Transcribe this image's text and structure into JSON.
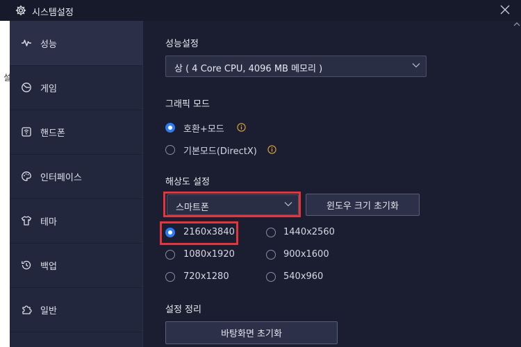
{
  "window": {
    "title": "시스템설정"
  },
  "left_edge_char": "설",
  "sidebar": {
    "items": [
      {
        "label": "성능",
        "icon": "pulse-icon",
        "active": true
      },
      {
        "label": "게임",
        "icon": "gauge-icon",
        "active": false
      },
      {
        "label": "핸드폰",
        "icon": "phone-icon",
        "active": false
      },
      {
        "label": "인터페이스",
        "icon": "palette-icon",
        "active": false
      },
      {
        "label": "테마",
        "icon": "shirt-icon",
        "active": false
      },
      {
        "label": "백업",
        "icon": "backup-icon",
        "active": false
      },
      {
        "label": "일반",
        "icon": "puzzle-icon",
        "active": false
      }
    ]
  },
  "performance": {
    "title": "성능설정",
    "selected": "상 ( 4 Core CPU, 4096 MB 메모리 )"
  },
  "graphics": {
    "title": "그래픽 모드",
    "options": [
      {
        "label": "호환+모드",
        "selected": true
      },
      {
        "label": "기본모드(DirectX)",
        "selected": false
      }
    ]
  },
  "resolution": {
    "title": "해상도 설정",
    "device_selected": "스마트폰",
    "reset_window_label": "윈도우 크기 초기화",
    "options": [
      {
        "label": "2160x3840",
        "selected": true
      },
      {
        "label": "1440x2560",
        "selected": false
      },
      {
        "label": "1080x1920",
        "selected": false
      },
      {
        "label": "900x1600",
        "selected": false
      },
      {
        "label": "720x1280",
        "selected": false
      },
      {
        "label": "540x960",
        "selected": false
      }
    ]
  },
  "cleanup": {
    "title": "설정 정리",
    "reset_desktop_label": "바탕화면 초기화"
  },
  "colors": {
    "accent": "#2d7cf2",
    "highlight": "#e5353a",
    "info": "#e0a43a"
  }
}
